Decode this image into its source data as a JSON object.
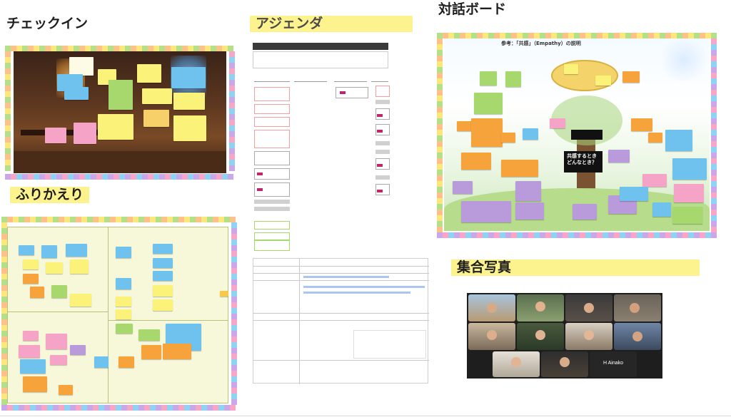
{
  "sections": {
    "checkin": {
      "title": "チェックイン"
    },
    "agenda": {
      "title": "アジェンダ"
    },
    "board": {
      "title": "対話ボード"
    },
    "reflection": {
      "title": "ふりかえり"
    },
    "group_photo": {
      "title": "集合写真"
    }
  },
  "board_text": {
    "main_title": "参考：「共感」（Empathy）の説明",
    "tree_label": "共感するとき\nどんなとき？"
  },
  "photo": {
    "name_tag": "H Ainako"
  },
  "colors": {
    "highlight": "#fdf38e",
    "note_yellow": "#fbf27a",
    "note_orange": "#f7a33b",
    "note_purple": "#b99bdc",
    "note_blue": "#6fc2ee",
    "note_green": "#a7d86e",
    "note_pink": "#f5a3c6"
  }
}
